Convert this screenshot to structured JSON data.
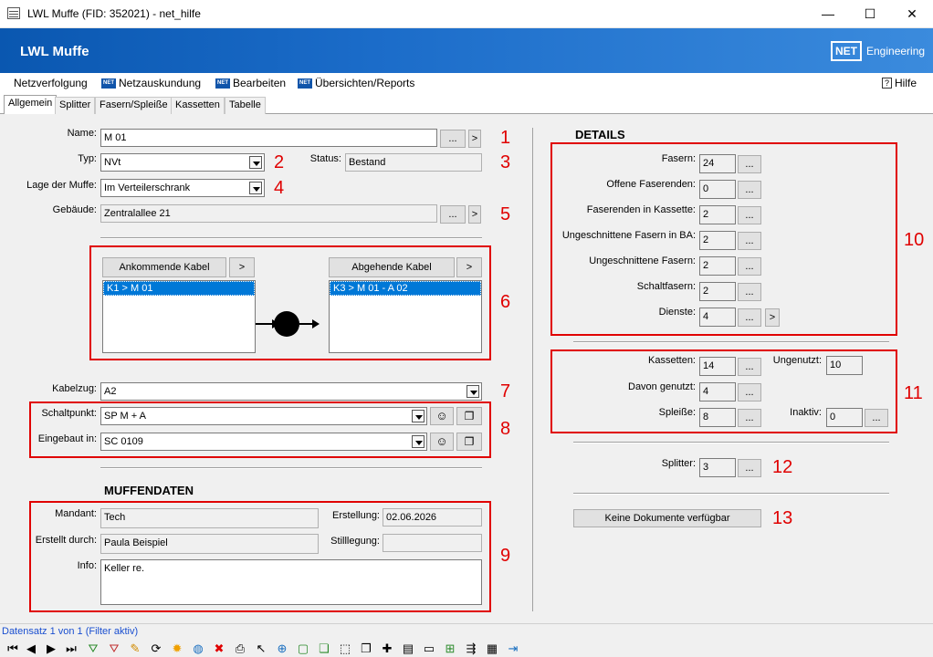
{
  "window": {
    "title": "LWL Muffe (FID: 352021) - net_hilfe",
    "minimize": "—",
    "maximize": "☐",
    "close": "✕"
  },
  "banner": {
    "title": "LWL Muffe",
    "logo_box": "NET",
    "logo_text": "Engineering"
  },
  "menu": {
    "items": [
      "Netzverfolgung",
      "Netzauskundung",
      "Bearbeiten",
      "Übersichten/Reports"
    ],
    "help": "Hilfe",
    "help_icon": "?"
  },
  "tabs": [
    "Allgemein",
    "Splitter",
    "Fasern/Spleiße",
    "Kassetten",
    "Tabelle"
  ],
  "general": {
    "name_label": "Name:",
    "name_value": "M 01",
    "typ_label": "Typ:",
    "typ_value": "NVt",
    "status_label": "Status:",
    "status_value": "Bestand",
    "lage_label": "Lage der Muffe:",
    "lage_value": "Im Verteilerschrank",
    "gebaeude_label": "Gebäude:",
    "gebaeude_value": "Zentralallee 21",
    "ellipsis": "...",
    "arrow": ">"
  },
  "cables": {
    "incoming_btn": "Ankommende Kabel",
    "outgoing_btn": "Abgehende Kabel",
    "incoming_items": [
      "K1 > M 01"
    ],
    "outgoing_items": [
      "K3 > M 01 - A 02"
    ]
  },
  "routing": {
    "kabelzug_label": "Kabelzug:",
    "kabelzug_value": "A2",
    "schaltpunkt_label": "Schaltpunkt:",
    "schaltpunkt_value": "SP M + A",
    "eingebaut_label": "Eingebaut in:",
    "eingebaut_value": "SC 0109"
  },
  "muffendaten": {
    "header": "MUFFENDATEN",
    "mandant_label": "Mandant:",
    "mandant_value": "Tech",
    "erstellung_label": "Erstellung:",
    "erstellung_value": "02.06.2026",
    "erstellt_label": "Erstellt durch:",
    "erstellt_value": "Paula Beispiel",
    "stilllegung_label": "Stilllegung:",
    "stilllegung_value": "",
    "info_label": "Info:",
    "info_value": "Keller re."
  },
  "details": {
    "header": "DETAILS",
    "rows": [
      {
        "label": "Fasern:",
        "value": "24"
      },
      {
        "label": "Offene Faserenden:",
        "value": "0"
      },
      {
        "label": "Faserenden in Kassette:",
        "value": "2"
      },
      {
        "label": "Ungeschnittene Fasern in BA:",
        "value": "2"
      },
      {
        "label": "Ungeschnittene Fasern:",
        "value": "2"
      },
      {
        "label": "Schaltfasern:",
        "value": "2"
      },
      {
        "label": "Dienste:",
        "value": "4"
      }
    ]
  },
  "kassetten": {
    "kassetten_label": "Kassetten:",
    "kassetten_value": "14",
    "ungenutzt_label": "Ungenutzt:",
    "ungenutzt_value": "10",
    "genutzt_label": "Davon genutzt:",
    "genutzt_value": "4",
    "spleisse_label": "Spleiße:",
    "spleisse_value": "8",
    "inaktiv_label": "Inaktiv:",
    "inaktiv_value": "0"
  },
  "splitter": {
    "label": "Splitter:",
    "value": "3"
  },
  "documents": {
    "button": "Keine Dokumente verfügbar"
  },
  "annotations": [
    "1",
    "2",
    "3",
    "4",
    "5",
    "6",
    "7",
    "8",
    "9",
    "10",
    "11",
    "12",
    "13"
  ],
  "status": {
    "record": "Datensatz 1 von 1 (Filter aktiv)"
  },
  "toolbar": {
    "nav": [
      "⏮",
      "◀",
      "▶",
      "⏭"
    ],
    "icons": [
      "filter-add-icon",
      "filter-icon",
      "pencil-icon",
      "refresh-icon",
      "sun-icon",
      "globe-icon",
      "delete-icon",
      "print-icon",
      "pointer-icon",
      "zoom-icon",
      "layer-icon",
      "copy-icon",
      "select-icon",
      "clone-icon",
      "new-icon",
      "doc-icon",
      "page-icon",
      "add-icon",
      "split-icon",
      "table-icon",
      "exit-icon"
    ]
  },
  "colors": {
    "annotation_red": "#e00000",
    "banner_blue": "#0a57b0",
    "selection_blue": "#0078d7"
  }
}
